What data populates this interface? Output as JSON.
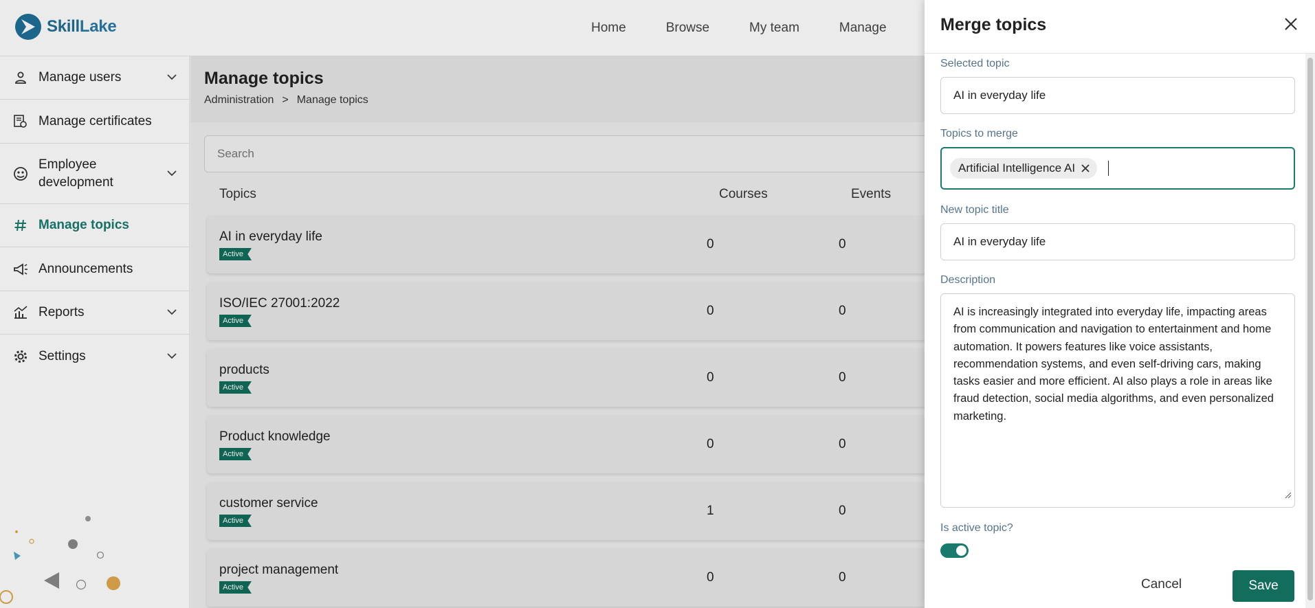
{
  "brand": {
    "name_part1": "Skill",
    "name_part2": "Lake"
  },
  "nav": [
    {
      "label": "Home"
    },
    {
      "label": "Browse"
    },
    {
      "label": "My team"
    },
    {
      "label": "Manage"
    }
  ],
  "sidebar": {
    "items": [
      {
        "label": "Manage users",
        "icon": "person-icon",
        "expandable": true
      },
      {
        "label": "Manage certificates",
        "icon": "certificate-icon",
        "expandable": false
      },
      {
        "label": "Employee development",
        "icon": "employee-development-icon",
        "expandable": true
      },
      {
        "label": "Manage topics",
        "icon": "hash-icon",
        "expandable": false,
        "active": true
      },
      {
        "label": "Announcements",
        "icon": "megaphone-icon",
        "expandable": false
      },
      {
        "label": "Reports",
        "icon": "chart-icon",
        "expandable": true
      },
      {
        "label": "Settings",
        "icon": "gear-icon",
        "expandable": true
      }
    ]
  },
  "page": {
    "title": "Manage topics",
    "breadcrumb": {
      "root": "Administration",
      "separator": ">",
      "current": "Manage topics"
    },
    "search_placeholder": "Search"
  },
  "table": {
    "headers": {
      "topics": "Topics",
      "courses": "Courses",
      "events": "Events"
    },
    "rows": [
      {
        "name": "AI in everyday life",
        "status": "Active",
        "courses": "0",
        "events": "0"
      },
      {
        "name": "ISO/IEC 27001:2022",
        "status": "Active",
        "courses": "0",
        "events": "0"
      },
      {
        "name": "products",
        "status": "Active",
        "courses": "0",
        "events": "0"
      },
      {
        "name": "Product knowledge",
        "status": "Active",
        "courses": "0",
        "events": "0"
      },
      {
        "name": "customer service",
        "status": "Active",
        "courses": "1",
        "events": "0"
      },
      {
        "name": "project management",
        "status": "Active",
        "courses": "0",
        "events": "0"
      }
    ]
  },
  "drawer": {
    "title": "Merge topics",
    "selected_topic_label": "Selected topic",
    "selected_topic_value": "AI in everyday life",
    "topics_to_merge_label": "Topics to merge",
    "topics_to_merge_chips": [
      "Artificial Intelligence AI"
    ],
    "new_title_label": "New topic title",
    "new_title_value": "AI in everyday life",
    "description_label": "Description",
    "description_value": "AI is increasingly integrated into everyday life, impacting areas from communication and navigation to entertainment and home automation. It powers features like voice assistants, recommendation systems, and even self-driving cars, making tasks easier and more efficient. AI also plays a role in areas like fraud detection, social media algorithms, and even personalized marketing.",
    "active_label": "Is active topic?",
    "active_value": true,
    "cancel_label": "Cancel",
    "save_label": "Save"
  },
  "colors": {
    "accent": "#126d5c",
    "brand": "#1f6f97"
  }
}
